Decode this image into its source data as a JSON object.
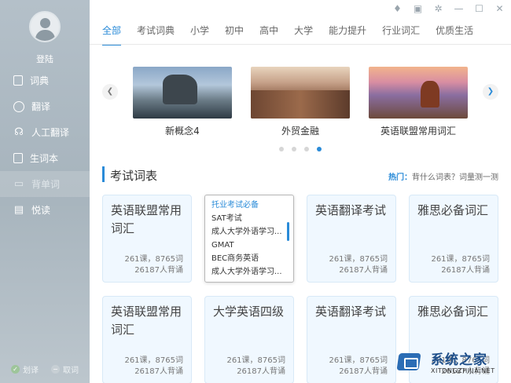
{
  "sidebar": {
    "login": "登陆",
    "items": [
      {
        "label": "词典",
        "icon": "dictionary-icon"
      },
      {
        "label": "翻译",
        "icon": "translate-icon"
      },
      {
        "label": "人工翻译",
        "icon": "headset-icon"
      },
      {
        "label": "生词本",
        "icon": "wordbook-icon"
      },
      {
        "label": "背单词",
        "icon": "flashcard-icon"
      },
      {
        "label": "悦读",
        "icon": "reading-icon"
      }
    ],
    "footer": {
      "left": "划译",
      "right": "取词"
    }
  },
  "window_controls": [
    "skin-icon",
    "message-icon",
    "settings-icon",
    "minimize-icon",
    "maximize-icon",
    "close-icon"
  ],
  "tabs": [
    "全部",
    "考试词典",
    "小学",
    "初中",
    "高中",
    "大学",
    "能力提升",
    "行业词汇",
    "优质生活"
  ],
  "carousel": {
    "slides": [
      "新概念4",
      "外贸金融",
      "英语联盟常用词汇"
    ],
    "active_dot": 4,
    "dot_count": 4
  },
  "section": {
    "title": "考试词表",
    "hot_label": "热门：",
    "hot_text": "背什么词表？词量测一测"
  },
  "dropdown": {
    "items": [
      "托业考试必备",
      "SAT考试",
      "成人大学外语学习...",
      "GMAT",
      "BEC商务英语",
      "成人大学外语学习..."
    ]
  },
  "cards": [
    {
      "title": "英语联盟常用词汇",
      "lessons": "261课，8765词",
      "learners": "26187人背诵"
    },
    {
      "title": "英语翻译考试",
      "lessons": "261课，8765词",
      "learners": "26187人背诵"
    },
    {
      "title": "雅思必备词汇",
      "lessons": "261课，8765词",
      "learners": "26187人背诵"
    },
    {
      "title": "英语联盟常用词汇",
      "lessons": "261课，8765词",
      "learners": "26187人背诵"
    },
    {
      "title": "大学英语四级",
      "lessons": "261课，8765词",
      "learners": "26187人背诵"
    },
    {
      "title": "英语翻译考试",
      "lessons": "261课，8765词",
      "learners": "26187人背诵"
    },
    {
      "title": "雅思必备词汇",
      "lessons": "261课，8765词",
      "learners": "26187人背诵"
    }
  ],
  "watermark": {
    "name": "系统之家",
    "url": "XITONGZHIJIA.NET"
  }
}
